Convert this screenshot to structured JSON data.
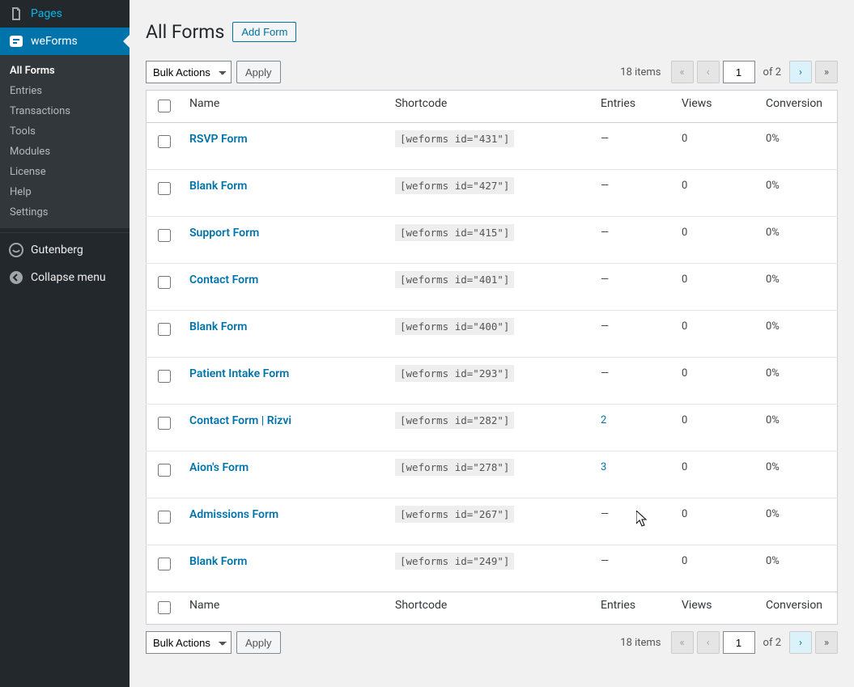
{
  "sidebar": {
    "top": [
      {
        "label": "Pages",
        "icon": "pages-icon"
      }
    ],
    "active": {
      "label": "weForms",
      "icon": "weforms-icon"
    },
    "submenu": [
      {
        "label": "All Forms",
        "current": true
      },
      {
        "label": "Entries"
      },
      {
        "label": "Transactions"
      },
      {
        "label": "Tools"
      },
      {
        "label": "Modules"
      },
      {
        "label": "License"
      },
      {
        "label": "Help"
      },
      {
        "label": "Settings"
      }
    ],
    "lower": [
      {
        "label": "Gutenberg",
        "icon": "gutenberg-icon"
      }
    ],
    "collapse_label": "Collapse menu"
  },
  "header": {
    "title": "All Forms",
    "add_button": "Add Form"
  },
  "bulk": {
    "select_label": "Bulk Actions",
    "apply_label": "Apply"
  },
  "pagination": {
    "count_text": "18 items",
    "current_page": "1",
    "of_text": "of 2",
    "glyphs": {
      "first": "«",
      "prev": "‹",
      "next": "›",
      "last": "»"
    }
  },
  "table": {
    "columns": {
      "name": "Name",
      "shortcode": "Shortcode",
      "entries": "Entries",
      "views": "Views",
      "conversion": "Conversion"
    },
    "rows": [
      {
        "name": "RSVP Form",
        "shortcode": "[weforms id=\"431\"]",
        "entries": "—",
        "entries_link": false,
        "views": "0",
        "conversion": "0%"
      },
      {
        "name": "Blank Form",
        "shortcode": "[weforms id=\"427\"]",
        "entries": "—",
        "entries_link": false,
        "views": "0",
        "conversion": "0%"
      },
      {
        "name": "Support Form",
        "shortcode": "[weforms id=\"415\"]",
        "entries": "—",
        "entries_link": false,
        "views": "0",
        "conversion": "0%"
      },
      {
        "name": "Contact Form",
        "shortcode": "[weforms id=\"401\"]",
        "entries": "—",
        "entries_link": false,
        "views": "0",
        "conversion": "0%"
      },
      {
        "name": "Blank Form",
        "shortcode": "[weforms id=\"400\"]",
        "entries": "—",
        "entries_link": false,
        "views": "0",
        "conversion": "0%"
      },
      {
        "name": "Patient Intake Form",
        "shortcode": "[weforms id=\"293\"]",
        "entries": "—",
        "entries_link": false,
        "views": "0",
        "conversion": "0%"
      },
      {
        "name": "Contact Form | Rizvi",
        "shortcode": "[weforms id=\"282\"]",
        "entries": "2",
        "entries_link": true,
        "views": "0",
        "conversion": "0%"
      },
      {
        "name": "Aion's Form",
        "shortcode": "[weforms id=\"278\"]",
        "entries": "3",
        "entries_link": true,
        "views": "0",
        "conversion": "0%"
      },
      {
        "name": "Admissions Form",
        "shortcode": "[weforms id=\"267\"]",
        "entries": "—",
        "entries_link": false,
        "views": "0",
        "conversion": "0%"
      },
      {
        "name": "Blank Form",
        "shortcode": "[weforms id=\"249\"]",
        "entries": "—",
        "entries_link": false,
        "views": "0",
        "conversion": "0%"
      }
    ]
  }
}
